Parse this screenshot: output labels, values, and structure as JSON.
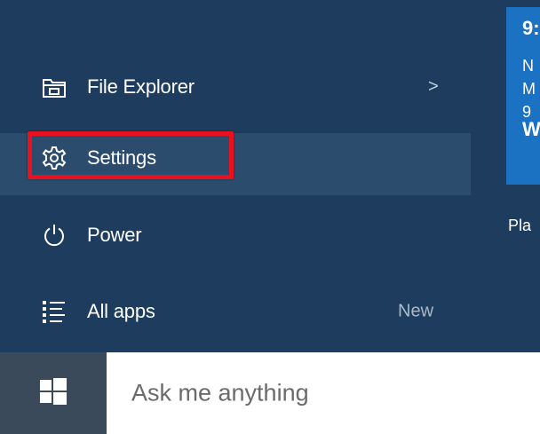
{
  "menu": {
    "file_explorer": {
      "label": "File Explorer",
      "chevron": ">",
      "icon": "folder-icon"
    },
    "settings": {
      "label": "Settings",
      "icon": "gear-icon"
    },
    "power": {
      "label": "Power",
      "icon": "power-icon"
    },
    "all_apps": {
      "label": "All apps",
      "badge": "New",
      "icon": "list-icon"
    }
  },
  "tile": {
    "lines": [
      "9:",
      "N",
      "M",
      "9",
      "W"
    ],
    "caption": "Pla"
  },
  "taskbar": {
    "start_icon": "windows-logo-icon",
    "search_placeholder": "Ask me anything"
  },
  "colors": {
    "menu_bg": "#1e3d5e",
    "selected_bg": "#2c4c6d",
    "highlight": "#e8111d",
    "tile": "#1c72c2"
  }
}
